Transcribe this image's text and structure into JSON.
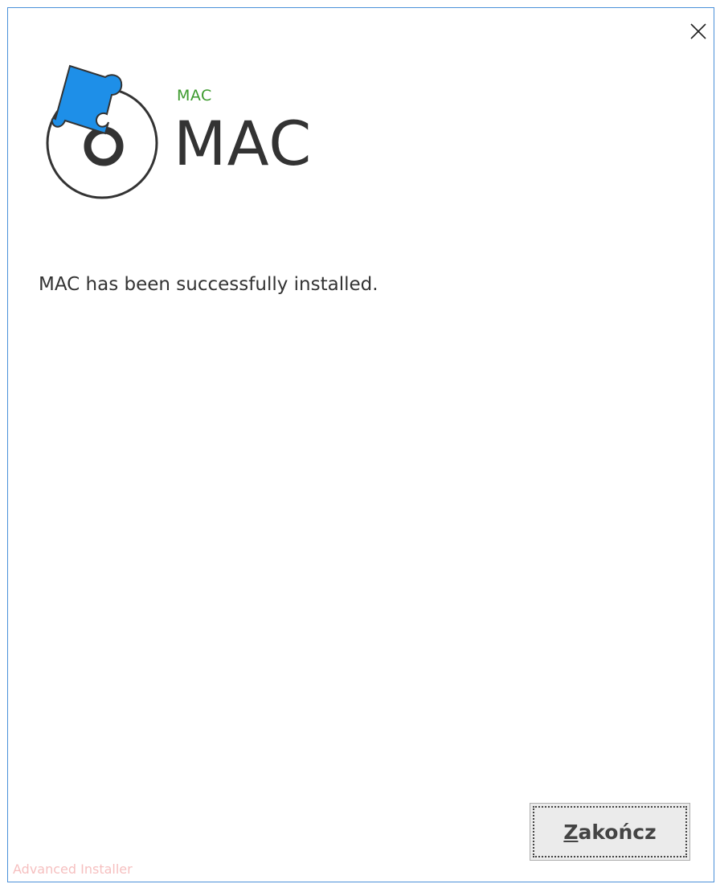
{
  "window": {
    "close_icon": "close-icon"
  },
  "header": {
    "product_small": "MAC",
    "product_large": "MAC",
    "logo_icon": "puzzle-disc-logo-icon"
  },
  "main": {
    "message": "MAC has been successfully installed."
  },
  "footer": {
    "finish_mnemonic": "Z",
    "finish_rest": "akończ",
    "branding": "Advanced Installer"
  },
  "colors": {
    "border": "#4a90d9",
    "logo_blue": "#1e8fe8",
    "product_small": "#3c9a2d",
    "text": "#333333"
  }
}
